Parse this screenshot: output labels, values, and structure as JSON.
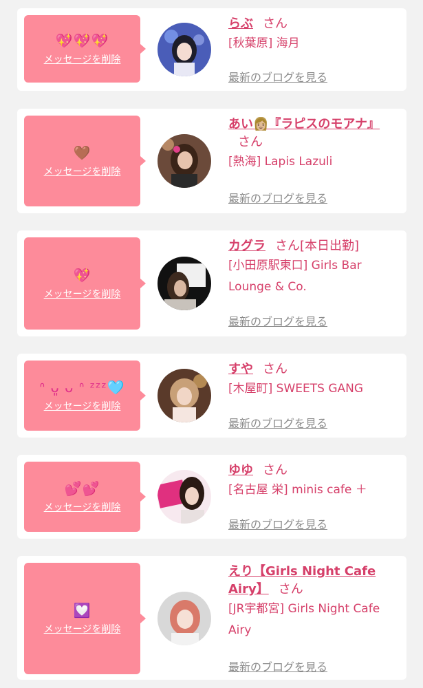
{
  "labels": {
    "delete": "メッセージを削除",
    "blog": "最新のブログを見る",
    "san": "さん"
  },
  "items": [
    {
      "emoji": "💖💖💖",
      "name": "らぶ",
      "note": "",
      "shop": "[秋葉原] 海月"
    },
    {
      "emoji": "🤎",
      "name": "あい👩🏼『ラピスのモアナ』",
      "note": "",
      "shop": "[熱海] Lapis Lazuli"
    },
    {
      "emoji": "💖",
      "name": "カグラ",
      "note": "[本日出勤]",
      "shop": "[小田原駅東口] Girls Bar Lounge & Co."
    },
    {
      "emoji": "ᐢ ᴗ͈ ᴗ ᐢ ᶻᶻᶻ🩵",
      "name": "すや",
      "note": "",
      "shop": "[木屋町] SWEETS GANG"
    },
    {
      "emoji": "💕💕",
      "name": "ゆゆ",
      "note": "",
      "shop": "[名古屋 栄] minis cafe ＋"
    },
    {
      "emoji": "💟",
      "name": "えり【Girls Night Cafe Airy】",
      "note": "",
      "shop": "[JR宇都宮] Girls Night Cafe Airy"
    }
  ],
  "colors": {
    "accent": "#d6406a",
    "message_box": "#fd8b9a",
    "link_gray": "#8a8a8a",
    "background": "#f2f2f2"
  },
  "icons": [
    "avatar-photo",
    "speech-bubble-arrow"
  ]
}
